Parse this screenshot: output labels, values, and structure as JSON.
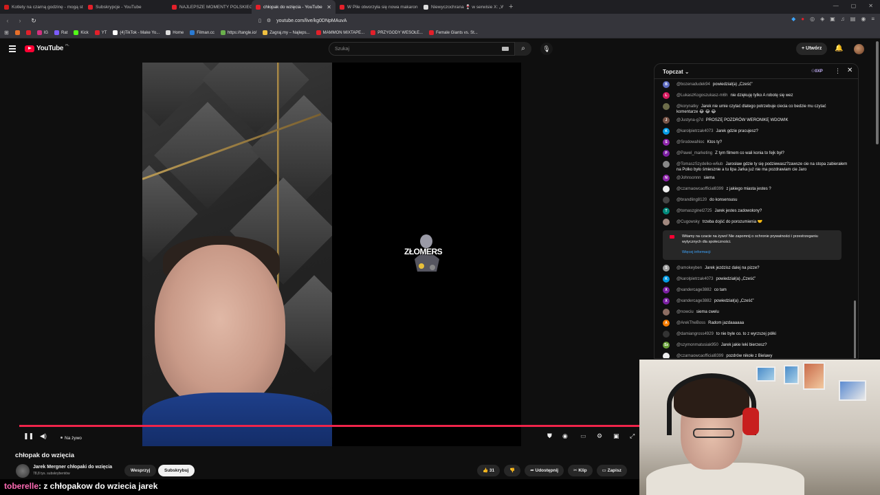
{
  "browser": {
    "tabs": [
      {
        "title": "Kotlety na czarną godzinę - mogą st",
        "color": "#d21c1c",
        "active": false
      },
      {
        "title": "Subskrypcje - YouTube",
        "color": "#e3202a",
        "active": false
      },
      {
        "title": "NAJLEPSZE MOMENTY POLSKIEGO",
        "color": "#e3202a",
        "active": false
      },
      {
        "title": "chłopak do wzięcia - YouTube",
        "color": "#e3202a",
        "active": true
      },
      {
        "title": "W Pile otworzyła się nowa makaron",
        "color": "#e3202a",
        "active": false
      },
      {
        "title": "Niewyczochrana 🍷 w serwisie X: „W",
        "color": "#dddddd",
        "active": false
      }
    ],
    "new_tab_symbol": "+",
    "url": "youtube.com/live/kg0DNpMAuvA",
    "bookmarks": [
      {
        "label": "",
        "color": "#e8702a"
      },
      {
        "label": "",
        "color": "#e3202a"
      },
      {
        "label": "IG",
        "color": "#d3317f"
      },
      {
        "label": "Rat",
        "color": "#7c5cff"
      },
      {
        "label": "Kick",
        "color": "#53fc18"
      },
      {
        "label": "YT",
        "color": "#e3202a"
      },
      {
        "label": "(4)TikTok - Make Yo...",
        "color": "#ffffff"
      },
      {
        "label": "Home",
        "color": "#dddddd"
      },
      {
        "label": "Filman.cc",
        "color": "#2a7bd4"
      },
      {
        "label": "https://tangle.io/",
        "color": "#6ab04c"
      },
      {
        "label": "Zagraj.my – Najleps...",
        "color": "#f0c040"
      },
      {
        "label": "MAMMON MIXTAPE...",
        "color": "#e3202a"
      },
      {
        "label": "PRZYGODY WESOŁE...",
        "color": "#e3202a"
      },
      {
        "label": "Female Giants vs. St...",
        "color": "#e3202a"
      }
    ]
  },
  "youtube": {
    "logo_text": "YouTube",
    "logo_country": "PL",
    "search_placeholder": "Szukaj",
    "create_label": "Utwórz",
    "brand_color": "#ff0033"
  },
  "video": {
    "overlay_logo_text": "ZŁOMERS",
    "live_label": "Na żywo",
    "title": "chłopak do wzięcia",
    "channel_name": "Jarek Mergner chłopaki do wzięcia",
    "subscribers": "78,8 tys. subskrybentów",
    "support_label": "Wesprzyj",
    "subscribe_label": "Subskrybuj",
    "likes": "31",
    "share_label": "Udostępnij",
    "clip_label": "Klip",
    "save_label": "Zapisz"
  },
  "chat": {
    "mode_label": "Topczat",
    "points_label": "0XP",
    "messages_top": [
      {
        "author": "@bozenadudek94",
        "text": "powiedział(a) „Cześć”",
        "avatar_color": "#5c6bc0",
        "initial": "B"
      },
      {
        "author": "@LukaszKogoszukasz-m6h",
        "text": "nie dziękuję tylko A robotę się wez",
        "avatar_color": "#d81b60",
        "initial": "L"
      },
      {
        "author": "@korynatky",
        "text": "Jarek nie umie czytać dlatego potrzebuje ciecia co bedzie mu czytać komentarze 😂 😂 😂",
        "avatar_color": "#6d6d4a",
        "initial": ""
      },
      {
        "author": "@Justyna-g7d",
        "text": "PROSZĘ POZDRÓW WERONIKĘ WDOWIK",
        "avatar_color": "#795548",
        "initial": "J"
      },
      {
        "author": "@karolpietrzak4073",
        "text": "Jarek gdzie pracujesz?",
        "avatar_color": "#039be5",
        "initial": "K"
      },
      {
        "author": "@SrodowaNoc",
        "text": "Ktos ty?",
        "avatar_color": "#8e24aa",
        "initial": "S"
      },
      {
        "author": "@Pawel_marketing",
        "text": "Z tym filmem co wali konia to fejk był?",
        "avatar_color": "#7b1fa2",
        "initial": "P"
      },
      {
        "author": "@TomaszSzydelko-w6ub",
        "text": "Jarosław gdzie ty się podziewasz?zawsze cie na stopa zabierałem na Polko było śmiesznie a tu lipa Jarka już nie ma pozdrawiam cie Jaro",
        "avatar_color": "#888888",
        "initial": ""
      },
      {
        "author": "@Johnsonnn",
        "text": "siema",
        "avatar_color": "#8e24aa",
        "initial": "N"
      },
      {
        "author": "@czarnaowcaofficial8399",
        "text": "z jakiego miasta jestes ?",
        "avatar_color": "#eeeeee",
        "initial": ""
      },
      {
        "author": "@brandling8120",
        "text": "do konsensusu",
        "avatar_color": "#444444",
        "initial": ""
      },
      {
        "author": "@tomaszginel2725",
        "text": "Jarek jestes zadowolony?",
        "avatar_color": "#00897b",
        "initial": "T"
      },
      {
        "author": "@Cugowsky",
        "text": "trzeba dojść do porozumienia 🤝",
        "avatar_color": "#a1887f",
        "initial": ""
      }
    ],
    "notice_text": "Witamy na czacie na żywo! Nie zapomnij o ochronie prywatności i przestrzeganiu wytycznych dla społeczności.",
    "notice_link": "Więcej informacji",
    "messages_bottom": [
      {
        "author": "@amokeyben",
        "text": "Jarek jezdzisz dalej na pizze?",
        "avatar_color": "#9e9e9e",
        "initial": "S"
      },
      {
        "author": "@karolpietrzak4073",
        "text": "powiedział(a) „Cześć”",
        "avatar_color": "#039be5",
        "initial": "K"
      },
      {
        "author": "@xandercage3882",
        "text": "co tam",
        "avatar_color": "#7b1fa2",
        "initial": "X"
      },
      {
        "author": "@xandercage3882",
        "text": "powiedział(a) „Cześć”",
        "avatar_color": "#7b1fa2",
        "initial": "X"
      },
      {
        "author": "@nowciu",
        "text": "siema cwelu",
        "avatar_color": "#8d6e63",
        "initial": ""
      },
      {
        "author": "@ArekTheBoss",
        "text": "Radom jazdaaaaaa",
        "avatar_color": "#f57c00",
        "initial": "A"
      },
      {
        "author": "@damiangross4929",
        "text": "to nie byle co. to z wyrzszej półki",
        "avatar_color": "#333333",
        "initial": ""
      },
      {
        "author": "@szymonmatusiak950",
        "text": "Jarek jakie leki bierzesz?",
        "avatar_color": "#689f38",
        "initial": "Sz"
      },
      {
        "author": "@czarnaowcaofficial8399",
        "text": "pozdrów nikole z Bielawy",
        "avatar_color": "#eeeeee",
        "initial": ""
      }
    ]
  },
  "overlay_message": {
    "user": "toberelle",
    "text": ": z chłopakow do wziecia jarek"
  }
}
